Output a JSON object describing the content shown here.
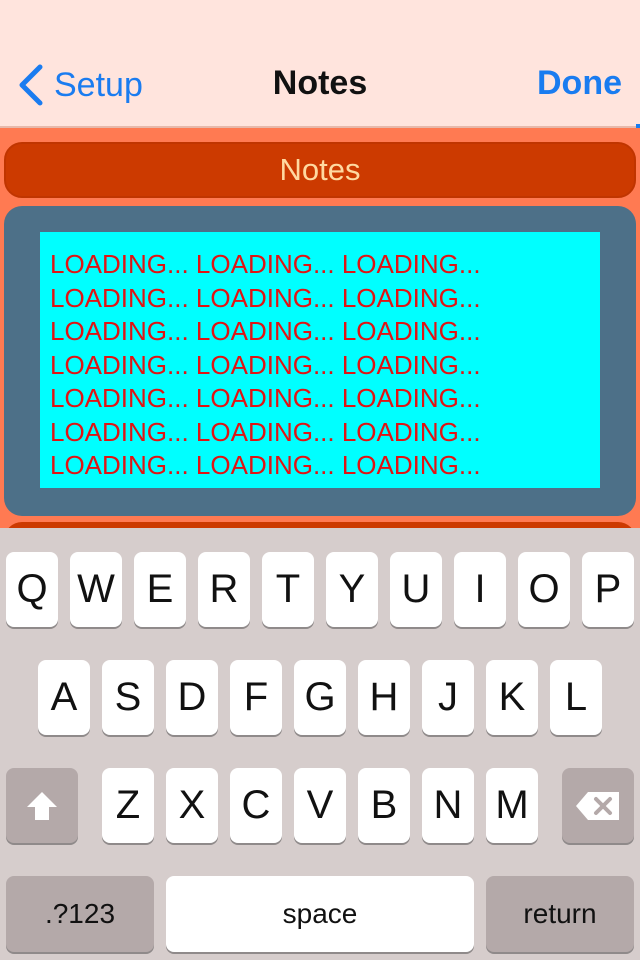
{
  "navbar": {
    "back_label": "Setup",
    "title": "Notes",
    "done_label": "Done"
  },
  "section": {
    "header": "Notes"
  },
  "notes": {
    "text": "LOADING... LOADING... LOADING...\nLOADING... LOADING... LOADING...\nLOADING... LOADING... LOADING...\nLOADING... LOADING... LOADING...\nLOADING... LOADING... LOADING...\nLOADING... LOADING... LOADING...\nLOADING... LOADING... LOADING..."
  },
  "keyboard": {
    "row1": [
      "Q",
      "W",
      "E",
      "R",
      "T",
      "Y",
      "U",
      "I",
      "O",
      "P"
    ],
    "row2": [
      "A",
      "S",
      "D",
      "F",
      "G",
      "H",
      "J",
      "K",
      "L"
    ],
    "row3": [
      "Z",
      "X",
      "C",
      "V",
      "B",
      "N",
      "M"
    ],
    "shift_icon": "shift-icon",
    "delete_icon": "backspace-icon",
    "numbers_label": ".?123",
    "space_label": "space",
    "return_label": "return"
  },
  "colors": {
    "accent": "#1a7cf0",
    "navbar_bg": "#ffe4dd",
    "page_bg": "#ff7a52",
    "header_bg": "#cc3a00",
    "header_text": "#ffd9a0",
    "panel_bg": "#4d7088",
    "notes_bg": "#00ffff",
    "notes_text": "#e01414"
  }
}
